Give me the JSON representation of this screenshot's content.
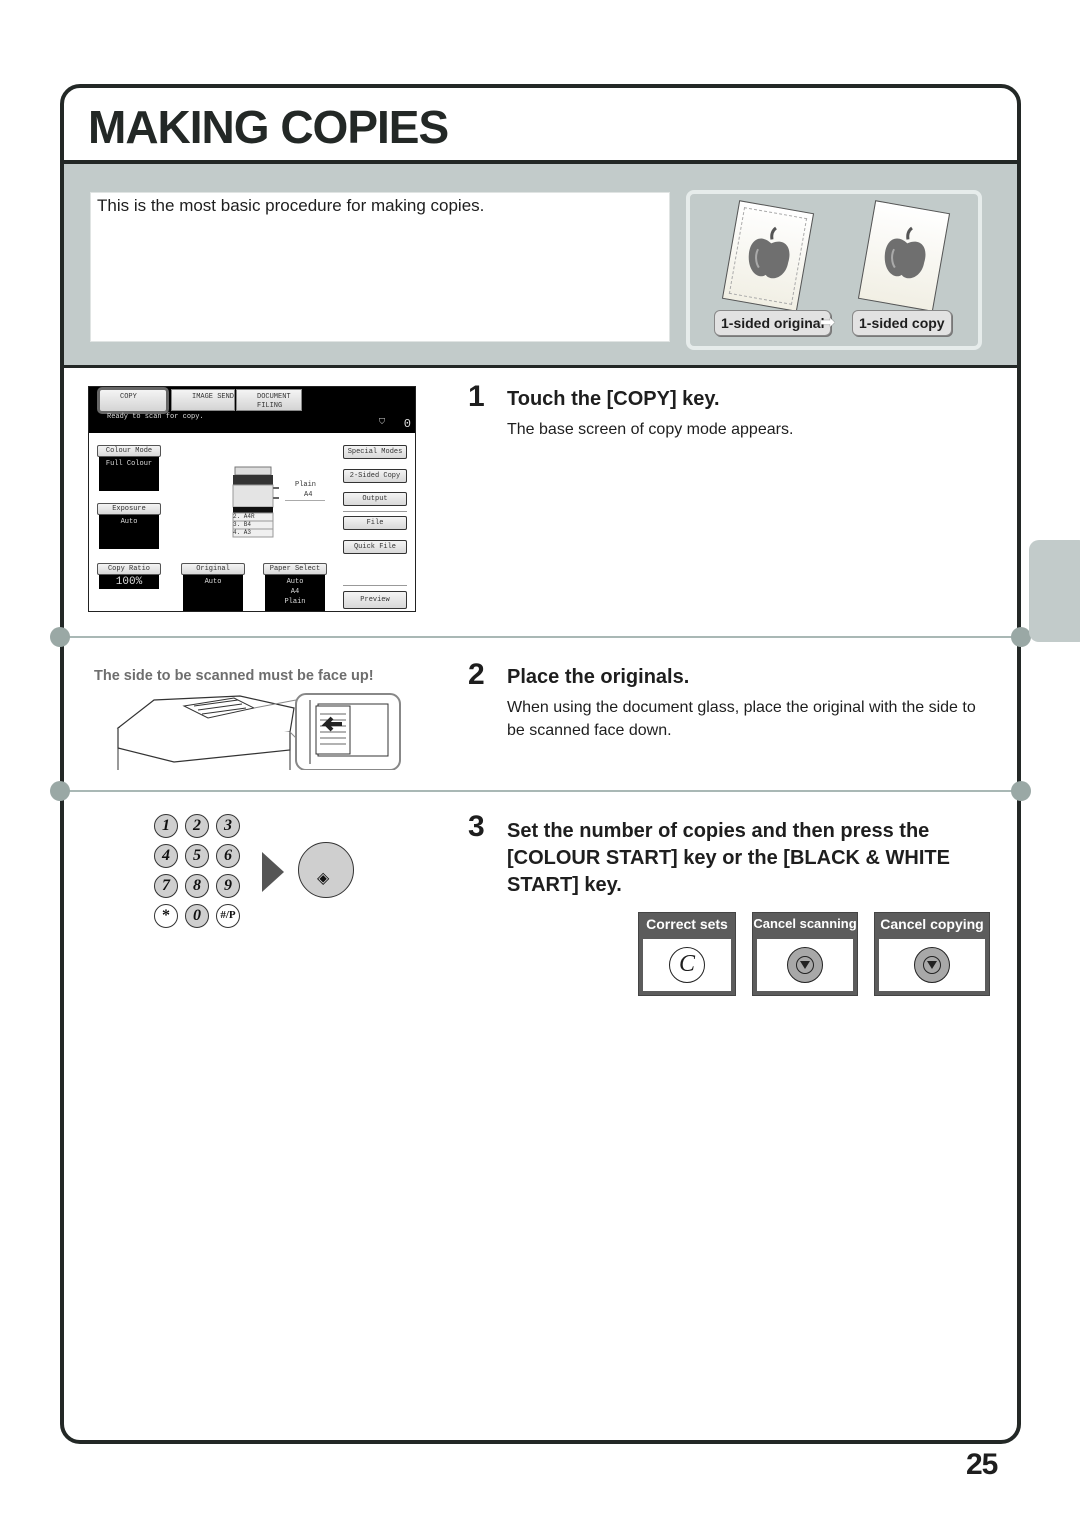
{
  "page": {
    "title": "MAKING COPIES",
    "intro": "This is the most basic procedure for making copies.",
    "page_number": "25",
    "colors": {
      "frame": "#232826",
      "band": "#c2cbca",
      "divider": "#a9b8b5",
      "option_header": "#5c5c5c"
    }
  },
  "illustration": {
    "original_label": "1-sided original",
    "copy_label": "1-sided copy",
    "arrow_icon": "right-arrow-icon"
  },
  "touch_screen": {
    "tabs": [
      {
        "label": "COPY",
        "selected": true
      },
      {
        "label": "IMAGE SEND"
      },
      {
        "label": "DOCUMENT FILING"
      }
    ],
    "status": "Ready to scan for copy.",
    "copy_count": "0",
    "colour_mode": {
      "label": "Colour Mode",
      "value": "Full Colour"
    },
    "exposure": {
      "label": "Exposure",
      "value": "Auto"
    },
    "copy_ratio": {
      "label": "Copy Ratio",
      "value": "100%"
    },
    "original": {
      "label": "Original",
      "value": "Auto"
    },
    "paper_select": {
      "label": "Paper Select",
      "value_1": "Auto",
      "value_2": "A4",
      "value_3": "Plain"
    },
    "tray_paper": {
      "type": "Plain",
      "size": "A4"
    },
    "trays": [
      "2. A4R",
      "3. B4",
      "4. A3"
    ],
    "right_buttons": [
      "Special Modes",
      "2-Sided Copy",
      "Output",
      "File",
      "Quick File"
    ],
    "preview_label": "Preview"
  },
  "steps": [
    {
      "number": "1",
      "title": "Touch the [COPY] key.",
      "description": "The base screen of copy mode appears."
    },
    {
      "number": "2",
      "title": "Place the originals.",
      "description": "When using the document glass, place the original with the side to be scanned face down."
    },
    {
      "number": "3",
      "title": "Set the number of copies and then press the [COLOUR START] key or the [BLACK & WHITE START] key.",
      "description": ""
    }
  ],
  "step2_note": "The side to be scanned must be face up!",
  "keypad": {
    "keys": [
      "1",
      "2",
      "3",
      "4",
      "5",
      "6",
      "7",
      "8",
      "9",
      "*",
      "0",
      "#/P"
    ],
    "start_icon": "start-diamond-icon"
  },
  "options": [
    {
      "label": "Correct sets",
      "icon": "clear-key-icon",
      "glyph": "C"
    },
    {
      "label": "Cancel scanning",
      "icon": "stop-key-icon"
    },
    {
      "label": "Cancel copying",
      "icon": "stop-key-icon"
    }
  ]
}
